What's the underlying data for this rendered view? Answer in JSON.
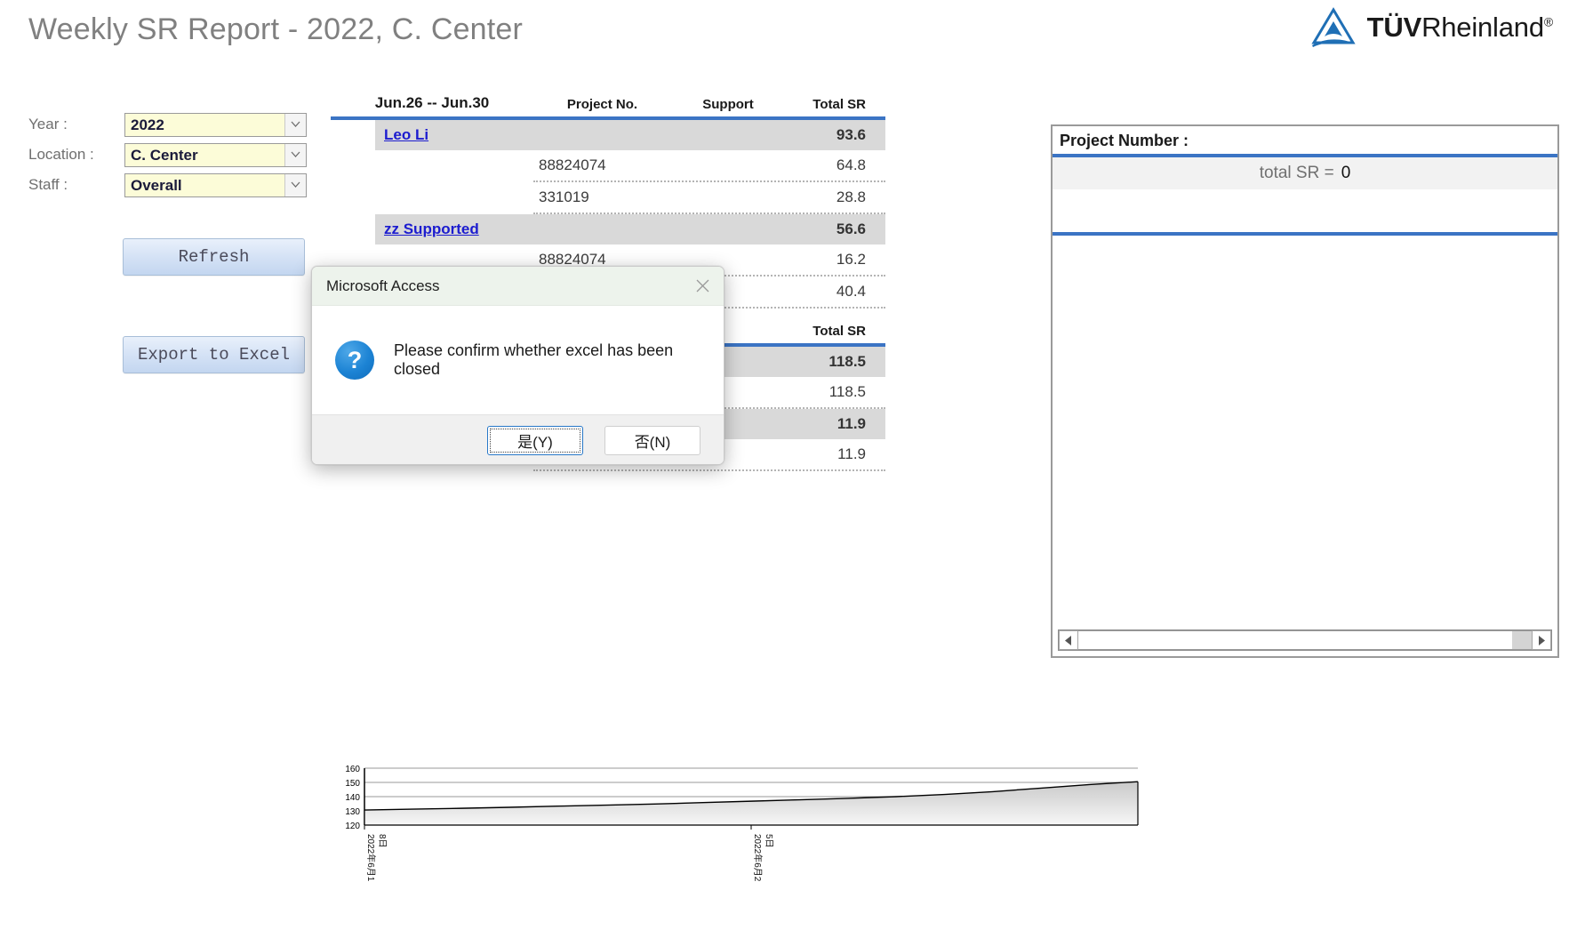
{
  "header": {
    "title": "Weekly SR Report - 2022, C. Center",
    "logo_text_bold": "TÜV",
    "logo_text_rest": "Rheinland",
    "logo_reg": "®",
    "logo_color": "#1f6fb5"
  },
  "filters": {
    "year": {
      "label": "Year :",
      "value": "2022"
    },
    "location": {
      "label": "Location :",
      "value": "C. Center"
    },
    "staff": {
      "label": "Staff :",
      "value": "Overall"
    }
  },
  "buttons": {
    "refresh": "Refresh",
    "export": "Export to Excel"
  },
  "report": {
    "date_range": "Jun.26  --  Jun.30",
    "columns": {
      "project_no": "Project No.",
      "support": "Support",
      "total_sr": "Total SR"
    },
    "rule_color": "#3b74c4",
    "groups": [
      {
        "name": "Leo Li",
        "total": "93.6",
        "rows": [
          {
            "project_no": "88824074",
            "support": "",
            "total": "64.8"
          },
          {
            "project_no": "331019",
            "support": "",
            "total": "28.8"
          }
        ]
      },
      {
        "name": "zz  Supported",
        "total": "56.6",
        "rows": [
          {
            "project_no": "88824074",
            "support": "",
            "total": "16.2"
          },
          {
            "project_no": "",
            "support": "",
            "total": "40.4"
          }
        ]
      }
    ],
    "section2": {
      "total_sr_header": "Total SR",
      "groups": [
        {
          "name": "",
          "total": "118.5",
          "rows": [
            {
              "project_no": "",
              "support": "",
              "total": "118.5"
            }
          ]
        },
        {
          "name": "",
          "total": "11.9",
          "rows": [
            {
              "project_no": "",
              "support": "",
              "total": "11.9"
            }
          ]
        }
      ]
    }
  },
  "side_panel": {
    "title": "Project Number :",
    "total_label": "total SR =",
    "total_value": "0"
  },
  "dialog": {
    "title": "Microsoft Access",
    "close_icon": "close-icon",
    "icon": "question-icon",
    "icon_glyph": "?",
    "message": "Please confirm whether excel has been closed",
    "yes_label": "是(Y)",
    "no_label": "否(N)"
  },
  "chart_data": {
    "type": "area",
    "title": "",
    "xlabel": "",
    "ylabel": "",
    "ylim": [
      120,
      160
    ],
    "yticks": [
      120,
      130,
      140,
      150,
      160
    ],
    "grid": true,
    "legend": "none",
    "x_tick_labels": [
      "2022年6月18日",
      "2022年6月25日"
    ],
    "x": [
      0,
      1,
      2,
      3,
      4,
      5,
      6,
      7,
      8,
      9,
      10,
      11,
      12,
      13,
      14,
      15,
      16
    ],
    "values": [
      130.6,
      131.2,
      131.8,
      132.5,
      133.3,
      134.0,
      134.8,
      135.8,
      136.8,
      137.8,
      138.8,
      140.0,
      141.5,
      143.5,
      146.0,
      148.5,
      150.5
    ],
    "line_color": "#000000",
    "fill_top": "#c9c9c9",
    "fill_bottom": "#f7f7f7"
  }
}
